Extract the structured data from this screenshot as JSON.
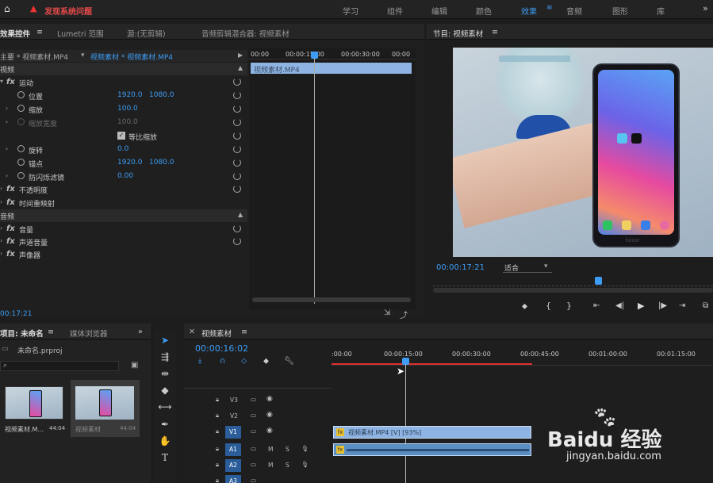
{
  "topbar": {
    "alert": "发现系统问题",
    "workspaces": [
      "学习",
      "组件",
      "编辑",
      "颜色",
      "效果",
      "音频",
      "图形",
      "库"
    ],
    "active_workspace": "效果"
  },
  "effects_panel": {
    "tabs": [
      "效果控件",
      "Lumetri 范围",
      "源:(无剪辑)",
      "音频剪辑混合器: 视频素材"
    ],
    "clip_master": "主要 * 视频素材.MP4",
    "clip_seq": "视频素材 * 视频素材.MP4",
    "ruler": [
      "00:00",
      "00:00:15:00",
      "00:00:30:00",
      "00:00"
    ],
    "clip_bar": "视频素材.MP4",
    "video_header": "视频",
    "motion": "运动",
    "position": {
      "label": "位置",
      "x": "1920.0",
      "y": "1080.0"
    },
    "scale": {
      "label": "缩放",
      "value": "100.0"
    },
    "scale_width": {
      "label": "缩放宽度",
      "value": "100.0"
    },
    "uniform": "等比缩放",
    "rotation": {
      "label": "旋转",
      "value": "0.0"
    },
    "anchor": {
      "label": "锚点",
      "x": "1920.0",
      "y": "1080.0"
    },
    "antiflicker": {
      "label": "防闪烁滤镜",
      "value": "0.00"
    },
    "opacity": "不透明度",
    "time_remap": "时间重映射",
    "audio_header": "音频",
    "volume": "音量",
    "channel_volume": "声道音量",
    "panner": "声像器",
    "timecode": "00:17:21"
  },
  "program_monitor": {
    "title": "节目: 视频素材",
    "timecode": "00:00:17:21",
    "fit": "适合"
  },
  "project_panel": {
    "tabs": [
      "项目: 未命名",
      "媒体浏览器"
    ],
    "project_file": "未命名.prproj",
    "items": [
      {
        "name": "视频素材.M...",
        "duration": "44:04"
      },
      {
        "name": "视频素材",
        "duration": "44:04"
      }
    ]
  },
  "timeline": {
    "title": "视频素材",
    "timecode": "00:00:16:02",
    "ruler": [
      ":00:00",
      "00:00:15:00",
      "00:00:30:00",
      "00:00:45:00",
      "00:01:00:00",
      "00:01:15:00"
    ],
    "tracks": [
      "V3",
      "V2",
      "V1",
      "A1",
      "A2",
      "A3"
    ],
    "video_clip": "视频素材.MP4 [V] [93%]",
    "m_label": "M",
    "s_label": "S"
  },
  "watermark": {
    "brand": "Baidu 经验",
    "url": "jingyan.baidu.com"
  },
  "phone": {
    "brand": "honor"
  },
  "colors": {
    "accent": "#3d9df5",
    "clip": "#8db4e2",
    "playhead_red": "#e03030"
  }
}
